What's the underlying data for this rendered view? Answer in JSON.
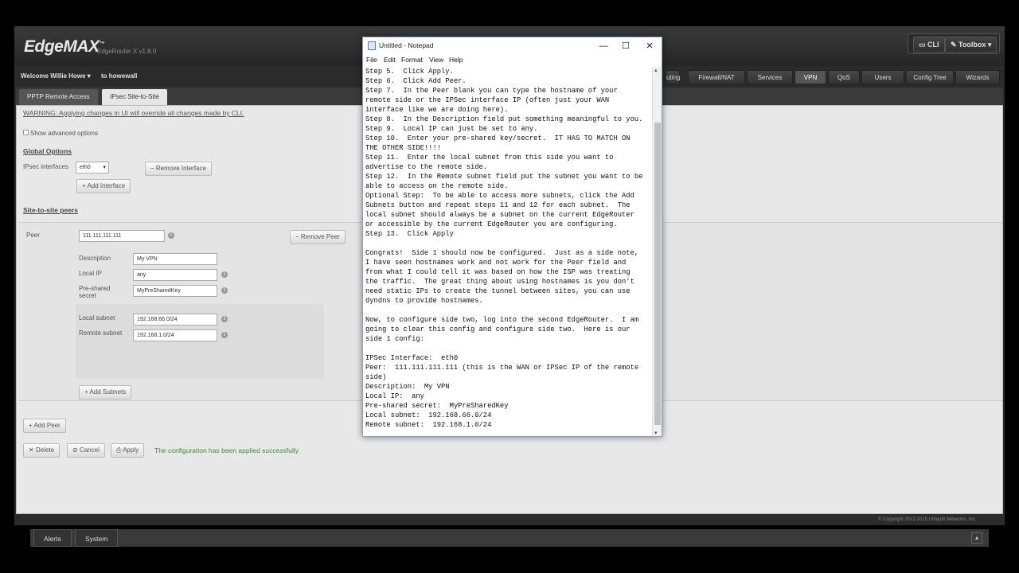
{
  "header": {
    "logo": "EdgeMAX",
    "model": "EdgeRouter X v1.8.0",
    "cli_label": "CLI",
    "toolbox_label": "Toolbox"
  },
  "navbar": {
    "welcome": "Welcome Willie Howe",
    "hostname": "to howewall",
    "tabs": [
      "uting",
      "Firewall/NAT",
      "Services",
      "VPN",
      "QoS",
      "Users",
      "Config Tree",
      "Wizards"
    ],
    "active_tab": "VPN"
  },
  "subtabs": {
    "pptp": "PPTP Remote Access",
    "ipsec": "IPsec Site-to-Site"
  },
  "panel": {
    "warning": "WARNING: Applying changes in UI will override all changes made by CLI.",
    "show_advanced": "Show advanced options",
    "global_options": "Global Options",
    "ipsec_interfaces_label": "IPsec interfaces",
    "ipsec_interface_value": "eth0",
    "remove_interface": "Remove Interface",
    "add_interface": "Add Interface",
    "site_to_site_peers": "Site-to-site peers",
    "peer_label": "Peer",
    "peer_value": "111.111.111.111",
    "remove_peer": "Remove Peer",
    "description_label": "Description",
    "description_value": "My VPN",
    "local_ip_label": "Local IP",
    "local_ip_value": "any",
    "psk_label_1": "Pre-shared",
    "psk_label_2": "secret",
    "psk_value": "MyPreSharedKey",
    "local_subnet_label": "Local subnet",
    "local_subnet_value": "192.168.66.0/24",
    "remote_subnet_label": "Remote subnet",
    "remote_subnet_value": "192.168.1.0/24",
    "add_subnets": "Add Subnets",
    "add_peer": "Add Peer",
    "delete": "Delete",
    "cancel": "Cancel",
    "apply": "Apply",
    "success": "The configuration has been applied successfully"
  },
  "footer": {
    "copyright": "© Copyright 2012-2015 Ubiquiti Networks, Inc.",
    "alerts": "Alerts",
    "system": "System"
  },
  "notepad": {
    "title": "Untitled - Notepad",
    "menu": [
      "File",
      "Edit",
      "Format",
      "View",
      "Help"
    ],
    "text": "Step 5.  Click Apply.\nStep 6.  Click Add Peer.\nStep 7.  In the Peer blank you can type the hostname of your\nremote side or the IPSec interface IP (often just your WAN\ninterface like we are doing here).\nStep 8.  In the Description field put something meaningful to you.\nStep 9.  Local IP can just be set to any.\nStep 10.  Enter your pre-shared key/secret.  IT HAS TO MATCH ON\nTHE OTHER SIDE!!!!\nStep 11.  Enter the local subnet from this side you want to\nadvertise to the remote side.\nStep 12.  In the Remote subnet field put the subnet you want to be\nable to access on the remote side.\nOptional Step:  To be able to access more subnets, click the Add\nSubnets button and repeat steps 11 and 12 for each subnet.  The\nlocal subnet should always be a subnet on the current EdgeRouter\nor accessible by the current EdgeRouter you are configuring.\nStep 13.  Click Apply\n\nCongrats!  Side 1 should now be configured.  Just as a side note,\nI have seen hostnames work and not work for the Peer field and\nfrom what I could tell it was based on how the ISP was treating\nthe traffic.  The great thing about using hostnames is you don't\nneed static IPs to create the tunnel between sites, you can use\ndyndns to provide hostnames.\n\nNow, to configure side two, log into the second EdgeRouter.  I am\ngoing to clear this config and configure side two.  Here is our\nside 1 config:\n\nIPSec Interface:  eth0\nPeer:  111.111.111.111 (this is the WAN or IPSec IP of the remote\nside)\nDescription:  My VPN\nLocal IP:  any\nPre-shared secret:  MyPreSharedKey\nLocal subnet:  192.168.66.0/24\nRemote subnet:  192.168.1.0/24"
  }
}
